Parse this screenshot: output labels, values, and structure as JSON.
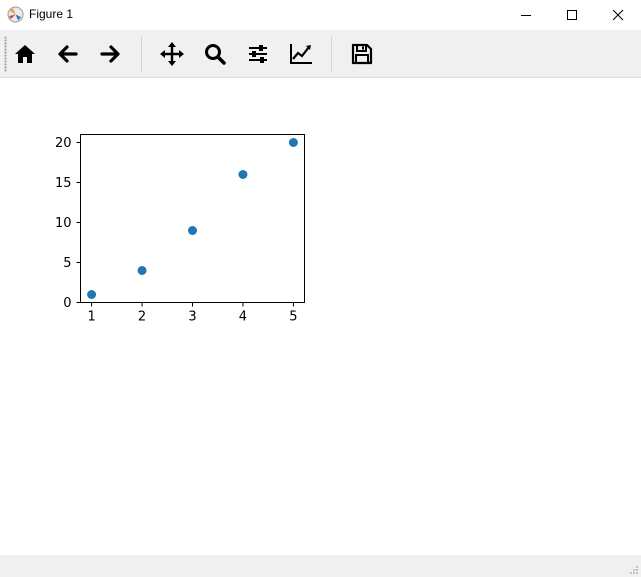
{
  "window": {
    "title": "Figure 1",
    "controls": [
      "minimize-icon",
      "maximize-icon",
      "close-icon"
    ]
  },
  "toolbar": {
    "tools": [
      {
        "icon": "home-icon",
        "action": "home"
      },
      {
        "icon": "back-arrow-icon",
        "action": "back"
      },
      {
        "icon": "forward-arrow-icon",
        "action": "forward"
      },
      {
        "icon": "pan-move-icon",
        "action": "pan"
      },
      {
        "icon": "zoom-magnifier-icon",
        "action": "zoom"
      },
      {
        "icon": "subplots-sliders-icon",
        "action": "configure-subplots"
      },
      {
        "icon": "edit-axes-chart-icon",
        "action": "edit-axes"
      },
      {
        "icon": "save-floppy-icon",
        "action": "save"
      }
    ]
  },
  "colors": {
    "marker": "#1f77b4",
    "toolbar_bg": "#f0f0f0",
    "icon": "#000000"
  },
  "chart_data": {
    "type": "scatter",
    "x": [
      1,
      2,
      3,
      4,
      5
    ],
    "y": [
      1,
      4,
      9,
      16,
      20
    ],
    "xticks": [
      "1",
      "2",
      "3",
      "4",
      "5"
    ],
    "yticks": [
      "0",
      "5",
      "10",
      "15",
      "20"
    ],
    "xlim": [
      0.78,
      5.22
    ],
    "ylim": [
      0,
      21
    ],
    "grid": false,
    "marker_color": "#1f77b4"
  }
}
